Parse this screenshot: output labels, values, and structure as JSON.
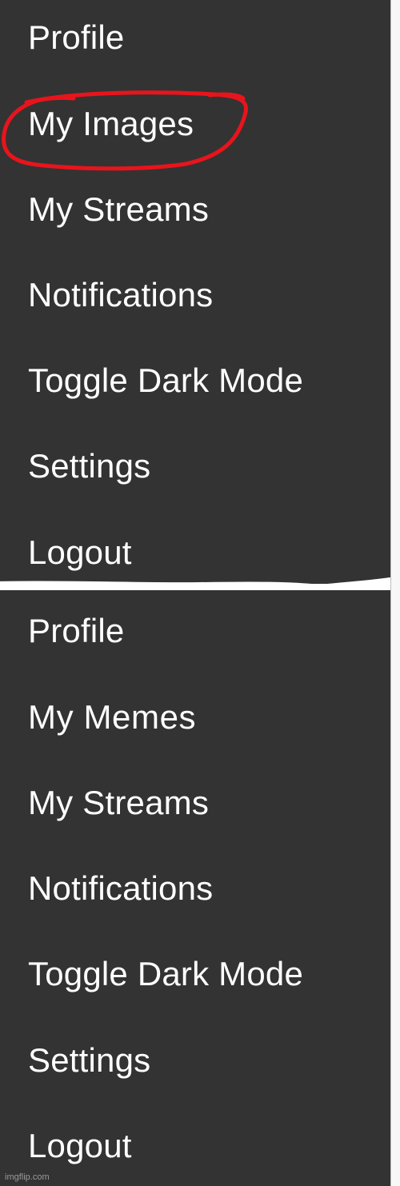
{
  "menu_before": {
    "items": [
      {
        "label": "Profile"
      },
      {
        "label": "My Images"
      },
      {
        "label": "My Streams"
      },
      {
        "label": "Notifications"
      },
      {
        "label": "Toggle Dark Mode"
      },
      {
        "label": "Settings"
      },
      {
        "label": "Logout"
      }
    ]
  },
  "menu_after": {
    "items": [
      {
        "label": "Profile"
      },
      {
        "label": "My Memes"
      },
      {
        "label": "My Streams"
      },
      {
        "label": "Notifications"
      },
      {
        "label": "Toggle Dark Mode"
      },
      {
        "label": "Settings"
      },
      {
        "label": "Logout"
      }
    ]
  },
  "watermark": "imgflip.com",
  "colors": {
    "menu_background": "#333333",
    "menu_text": "#ffffff",
    "highlight_circle": "#e8141c",
    "divider_stroke": "#ffffff"
  }
}
